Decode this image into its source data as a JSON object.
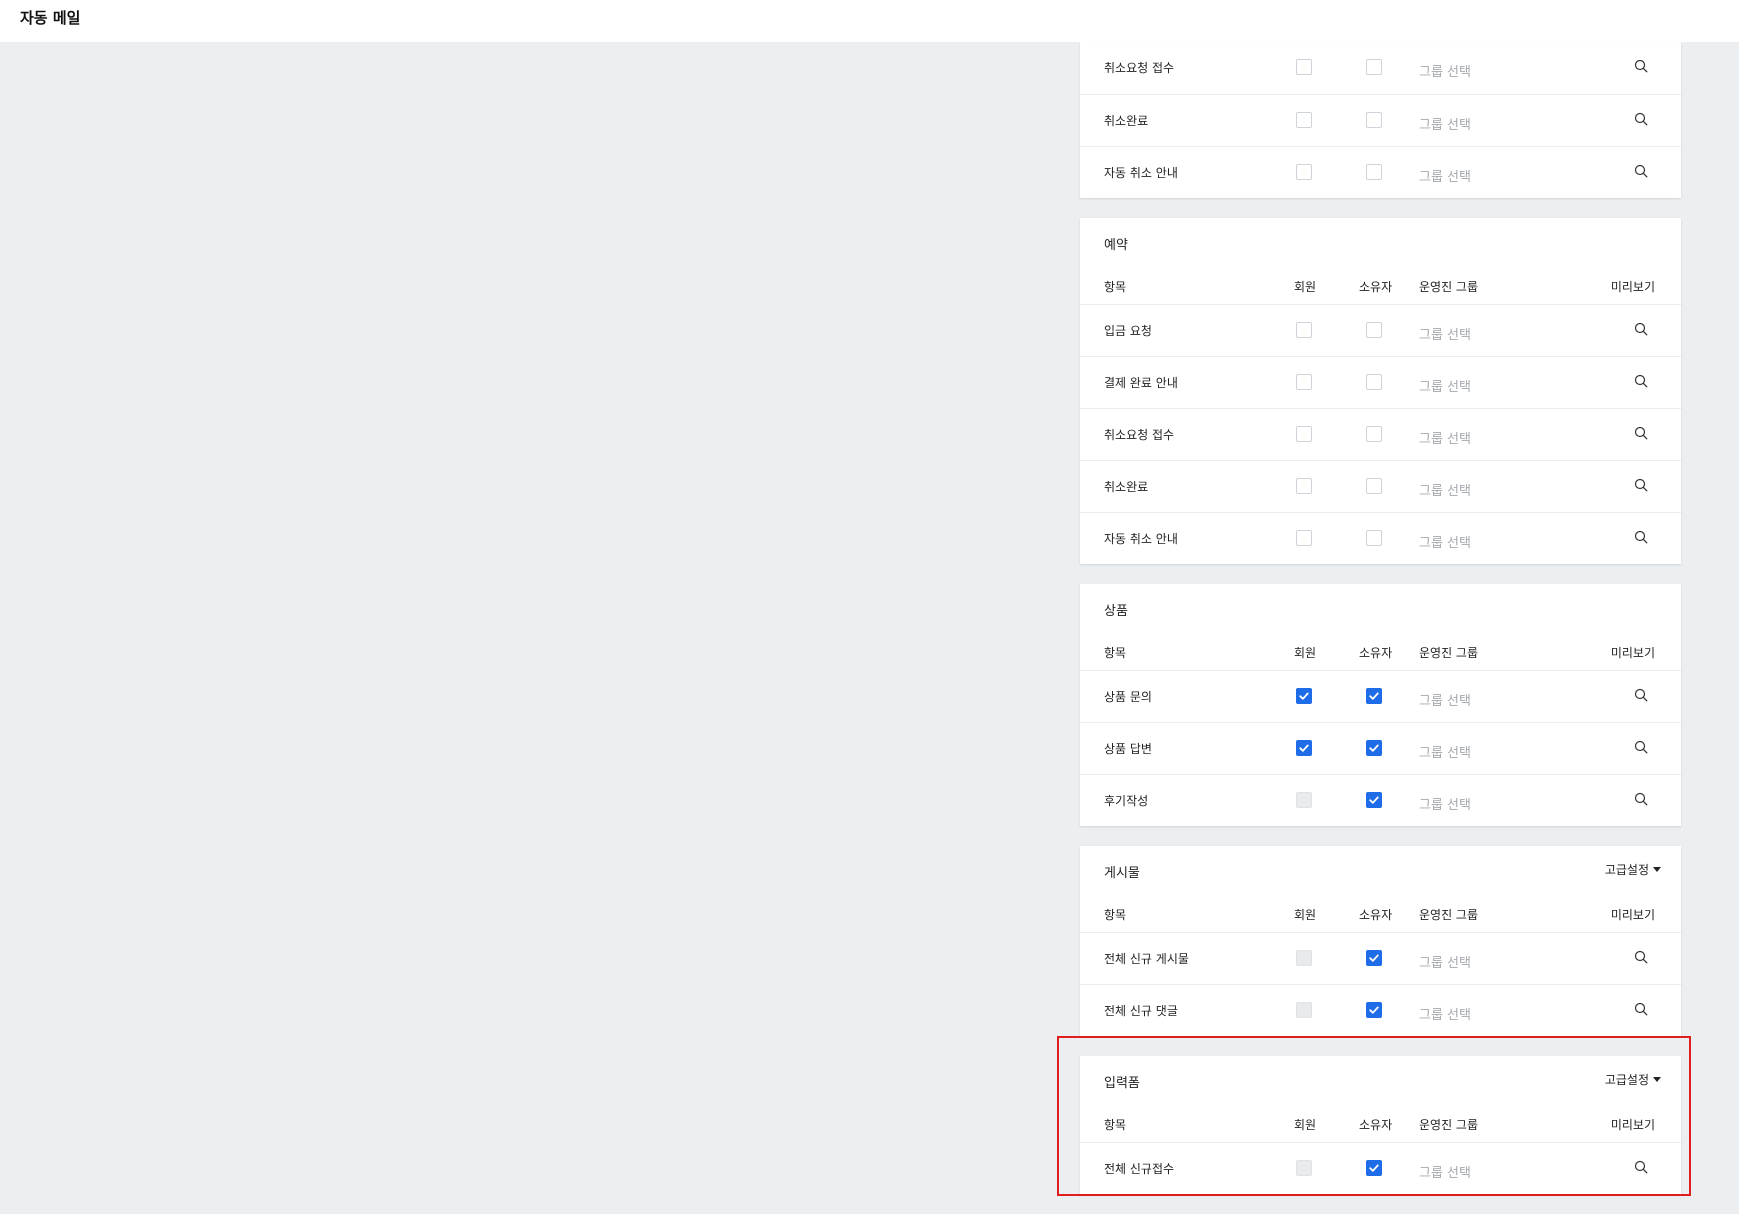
{
  "header": {
    "title": "자동 메일"
  },
  "columns": {
    "item": "항목",
    "member": "회원",
    "owner": "소유자",
    "group": "운영진 그룹",
    "preview": "미리보기"
  },
  "group_placeholder": "그룹 선택",
  "advanced_label": "고급설정",
  "colors": {
    "accent": "#1e6ce8",
    "highlight": "#e01e1e"
  },
  "sections": [
    {
      "id": "prev",
      "title": "",
      "rows": [
        {
          "label": "취소요청 접수",
          "member": "unchecked",
          "owner": "unchecked"
        },
        {
          "label": "취소완료",
          "member": "unchecked",
          "owner": "unchecked"
        },
        {
          "label": "자동 취소 안내",
          "member": "unchecked",
          "owner": "unchecked"
        }
      ]
    },
    {
      "id": "reservation",
      "title": "예약",
      "rows": [
        {
          "label": "입금 요청",
          "member": "unchecked",
          "owner": "unchecked"
        },
        {
          "label": "결제 완료 안내",
          "member": "unchecked",
          "owner": "unchecked"
        },
        {
          "label": "취소요청 접수",
          "member": "unchecked",
          "owner": "unchecked"
        },
        {
          "label": "취소완료",
          "member": "unchecked",
          "owner": "unchecked"
        },
        {
          "label": "자동 취소 안내",
          "member": "unchecked",
          "owner": "unchecked"
        }
      ]
    },
    {
      "id": "product",
      "title": "상품",
      "rows": [
        {
          "label": "상품 문의",
          "member": "checked",
          "owner": "checked"
        },
        {
          "label": "상품 답변",
          "member": "checked",
          "owner": "checked"
        },
        {
          "label": "후기작성",
          "member": "disabled",
          "owner": "checked"
        }
      ]
    },
    {
      "id": "post",
      "title": "게시물",
      "rows": [
        {
          "label": "전체 신규 게시물",
          "member": "disabled",
          "owner": "checked"
        },
        {
          "label": "전체 신규 댓글",
          "member": "disabled",
          "owner": "checked"
        }
      ]
    },
    {
      "id": "form",
      "title": "입력폼",
      "rows": [
        {
          "label": "전체 신규접수",
          "member": "disabled",
          "owner": "checked"
        }
      ]
    }
  ]
}
